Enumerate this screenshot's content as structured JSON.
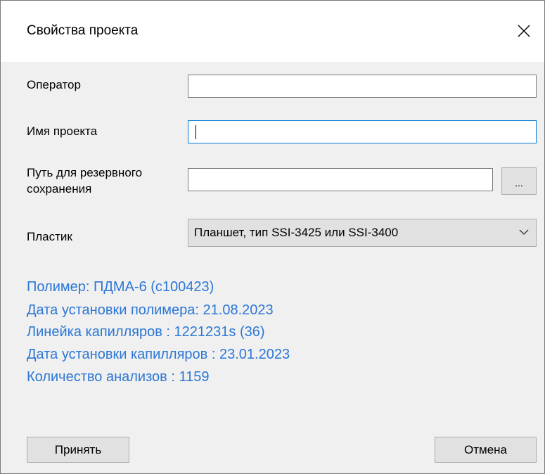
{
  "window": {
    "title": "Свойства проекта",
    "close_symbol": "×"
  },
  "form": {
    "operator": {
      "label": "Оператор",
      "value": ""
    },
    "project_name": {
      "label": "Имя проекта",
      "value": ""
    },
    "backup_path": {
      "label_line1": "Путь для резервного",
      "label_line2": "сохранения",
      "value": "",
      "browse_label": "..."
    },
    "plastic": {
      "label": "Пластик",
      "selected": "Планшет, тип SSI-3425 или SSI-3400"
    }
  },
  "info": {
    "polymer": "Полимер: ПДМА-6 (с100423)",
    "polymer_date": "Дата установки полимера: 21.08.2023",
    "capillary_array": "Линейка капилляров : 1221231s (36)",
    "capillary_date": "Дата установки капилляров : 23.01.2023",
    "analysis_count": "Количество анализов : 1159"
  },
  "buttons": {
    "accept": "Принять",
    "cancel": "Отмена"
  },
  "colors": {
    "info_text": "#2b77d6",
    "focus_border": "#0078d7",
    "background": "#f0f0f0"
  },
  "icons": {
    "close": "close-icon",
    "dropdown": "chevron-down-icon"
  }
}
